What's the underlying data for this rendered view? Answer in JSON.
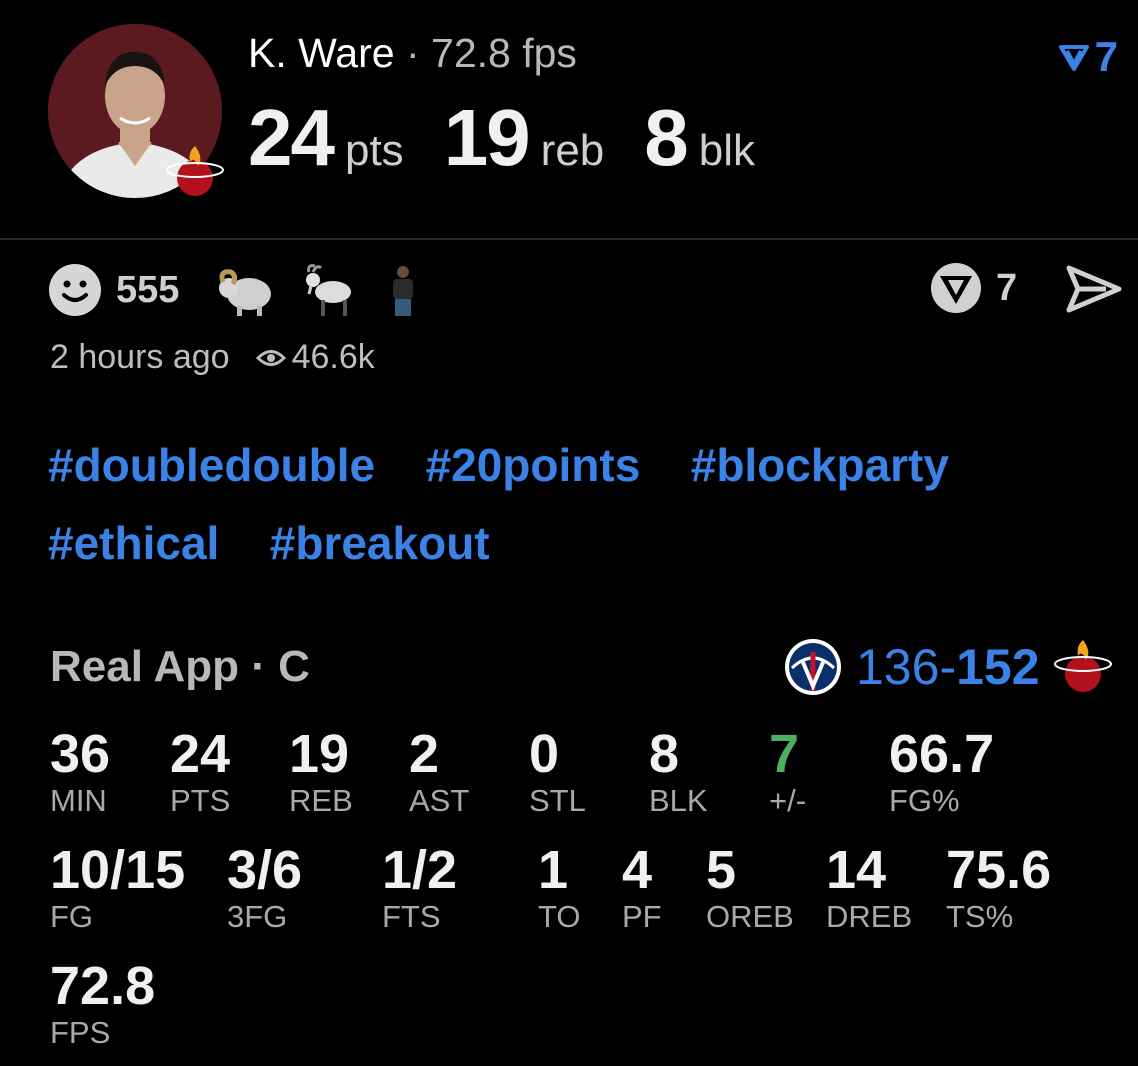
{
  "header": {
    "player_name": "K. Ware",
    "separator": " · ",
    "fps_text": "72.8 fps",
    "big_stats": [
      {
        "value": "24",
        "unit": "pts"
      },
      {
        "value": "19",
        "unit": "reb"
      },
      {
        "value": "8",
        "unit": "blk"
      }
    ],
    "vote_count": "7",
    "avatar_icon": "player-avatar",
    "team_icon": "heat-logo-icon"
  },
  "reactions": {
    "smile_count": "555",
    "icons": [
      "smile-icon",
      "ram-icon",
      "goat-icon",
      "player-emoji-icon"
    ],
    "vote_count": "7",
    "vote_icon": "v-vote-icon",
    "send_icon": "send-icon"
  },
  "meta": {
    "time_ago": "2 hours ago",
    "views": "46.6k"
  },
  "tags": [
    "#doubledouble",
    "#20points",
    "#blockparty",
    "#ethical",
    "#breakout"
  ],
  "game": {
    "source": "Real App · C",
    "away_score": "136",
    "dash": "-",
    "home_score": "152",
    "away_icon": "wizards-logo-icon",
    "home_icon": "heat-logo-icon"
  },
  "stats": [
    {
      "value": "36",
      "label": "MIN"
    },
    {
      "value": "24",
      "label": "PTS"
    },
    {
      "value": "19",
      "label": "REB"
    },
    {
      "value": "2",
      "label": "AST"
    },
    {
      "value": "0",
      "label": "STL"
    },
    {
      "value": "8",
      "label": "BLK"
    },
    {
      "value": "7",
      "label": "+/-"
    },
    {
      "value": "66.7",
      "label": "FG%"
    },
    {
      "value": "10/15",
      "label": "FG"
    },
    {
      "value": "3/6",
      "label": "3FG"
    },
    {
      "value": "1/2",
      "label": "FTS"
    },
    {
      "value": "1",
      "label": "TO"
    },
    {
      "value": "4",
      "label": "PF"
    },
    {
      "value": "5",
      "label": "OREB"
    },
    {
      "value": "14",
      "label": "DREB"
    },
    {
      "value": "75.6",
      "label": "TS%"
    },
    {
      "value": "72.8",
      "label": "FPS"
    }
  ],
  "colors": {
    "accent_blue": "#3b82e6",
    "plus_minus_green": "#4caf62",
    "background": "#000000"
  }
}
